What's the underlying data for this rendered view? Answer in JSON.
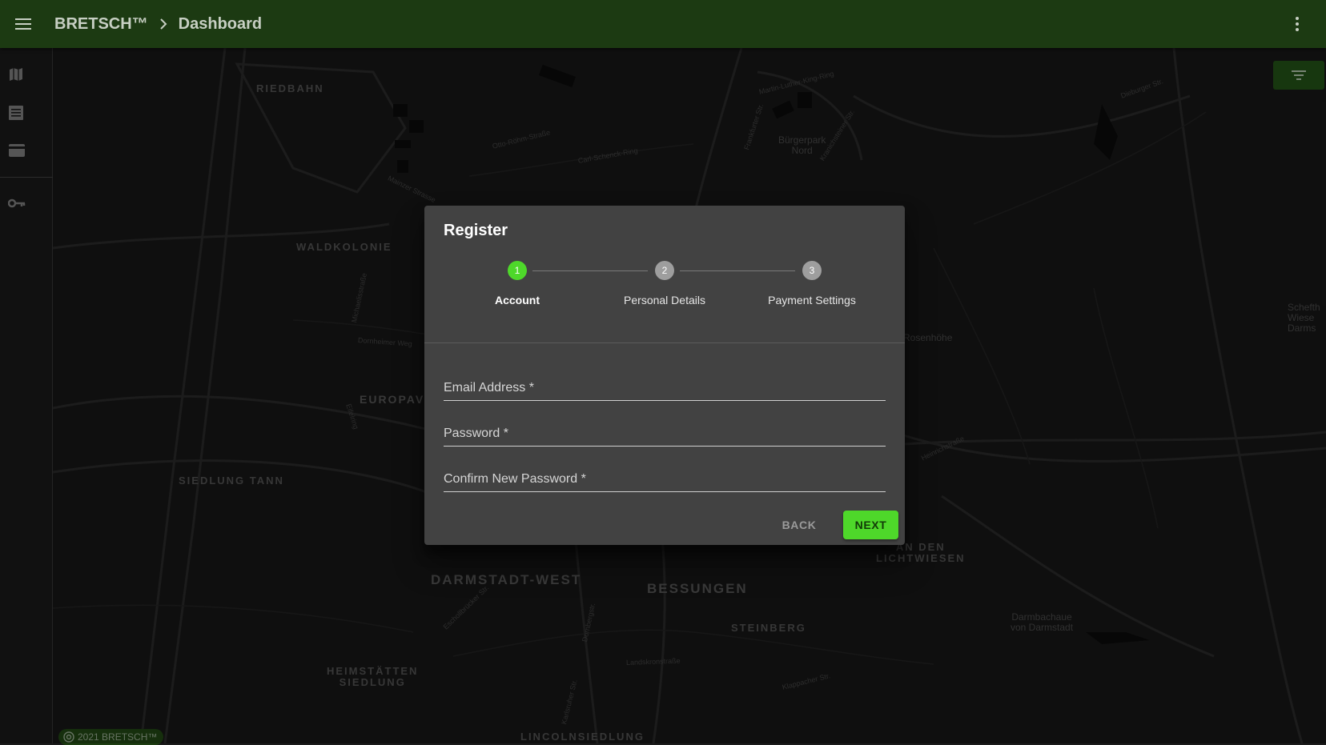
{
  "appbar": {
    "brand": "BRETSCH™",
    "page": "Dashboard"
  },
  "sidebar": {
    "items": [
      {
        "icon": "map-icon"
      },
      {
        "icon": "list-icon"
      },
      {
        "icon": "credit-card-icon"
      },
      {
        "icon": "key-icon"
      }
    ]
  },
  "map": {
    "places": [
      "RIEDBAHN",
      "WALDKOLONIE",
      "EUROPAV",
      "SIEDLUNG TANN",
      "DARMSTADT-WEST",
      "BESSUNGEN",
      "STEINBERG",
      "HEIMSTÄTTEN\nSIEDLUNG",
      "LINCOLNSIEDLUNG",
      "AN DEN\nLICHTWIESEN"
    ],
    "labels": [
      "Bürgerpark\nNord",
      "Rosenhöhe",
      "Darmbachaue\nvon Darmstadt",
      "Schefth\nWiese\nDarms"
    ],
    "streets": [
      "Otto-Röhm-Straße",
      "Carl-Schenck-Ring",
      "Mainzer Strasse",
      "Martin-Luther-King-Ring",
      "Dieburger Str.",
      "Dornheimer Weg",
      "Michaelisstraße",
      "Eifelring",
      "Heinrichstraße",
      "Eschollbrücker Str.",
      "Dornbergstr.",
      "Landskronstraße",
      "Karlsruher Str.",
      "Klappacher Str.",
      "Frankfurter Str.",
      "Kranichsteiner Str."
    ],
    "copyright": "2021 BRETSCH™"
  },
  "dialog": {
    "title": "Register",
    "steps": [
      {
        "number": "1",
        "label": "Account",
        "active": true
      },
      {
        "number": "2",
        "label": "Personal Details",
        "active": false
      },
      {
        "number": "3",
        "label": "Payment Settings",
        "active": false
      }
    ],
    "fields": {
      "email": {
        "label": "Email Address *",
        "value": ""
      },
      "password": {
        "label": "Password *",
        "value": ""
      },
      "confirm": {
        "label": "Confirm New Password *",
        "value": ""
      }
    },
    "back_label": "BACK",
    "next_label": "NEXT"
  },
  "colors": {
    "accent": "#4ed82a",
    "appbar": "#1c3a12",
    "dialog": "#424242"
  }
}
